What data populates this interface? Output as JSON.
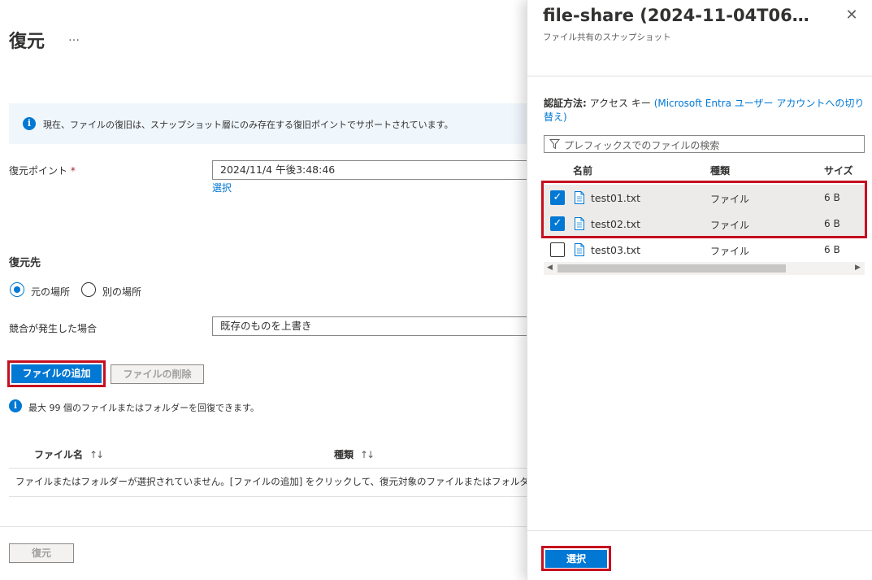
{
  "main": {
    "title": "復元",
    "more": "…",
    "info_banner": "現在、ファイルの復旧は、スナップショット層にのみ存在する復旧ポイントでサポートされています。",
    "restore_point": {
      "label": "復元ポイント",
      "required_mark": "*",
      "value": "2024/11/4 午後3:48:46",
      "select_link": "選択"
    },
    "destination": {
      "heading": "復元先",
      "options": [
        {
          "label": "元の場所",
          "checked": true
        },
        {
          "label": "別の場所",
          "checked": false
        }
      ]
    },
    "conflict": {
      "label": "競合が発生した場合",
      "value": "既存のものを上書き"
    },
    "add_files_button": "ファイルの追加",
    "remove_files_button": "ファイルの削除",
    "max_hint": "最大 99 個のファイルまたはフォルダーを回復できます。",
    "table": {
      "columns": [
        "ファイル名",
        "種類"
      ],
      "sort_icon": "↑↓",
      "empty_message": "ファイルまたはフォルダーが選択されていません。[ファイルの追加] をクリックして、復元対象のファイルまたはフォルダーを追加してく"
    },
    "restore_button": "復元"
  },
  "panel": {
    "title": "file-share (2024-11-04T06…",
    "subtitle": "ファイル共有のスナップショット",
    "close": "✕",
    "auth_label": "認証方法:",
    "auth_value": "アクセス キー",
    "auth_link": "(Microsoft Entra ユーザー アカウントへの切り替え)",
    "search_placeholder": "プレフィックスでのファイルの検索",
    "columns": {
      "name": "名前",
      "type": "種類",
      "size": "サイズ"
    },
    "files": [
      {
        "name": "test01.txt",
        "type": "ファイル",
        "size": "6 B",
        "checked": true
      },
      {
        "name": "test02.txt",
        "type": "ファイル",
        "size": "6 B",
        "checked": true
      },
      {
        "name": "test03.txt",
        "type": "ファイル",
        "size": "6 B",
        "checked": false
      }
    ],
    "select_button": "選択"
  },
  "colors": {
    "accent": "#0078d4",
    "highlight_box": "#c50f1f",
    "info_background": "#eff6fc",
    "selected_row": "#edebe9"
  }
}
